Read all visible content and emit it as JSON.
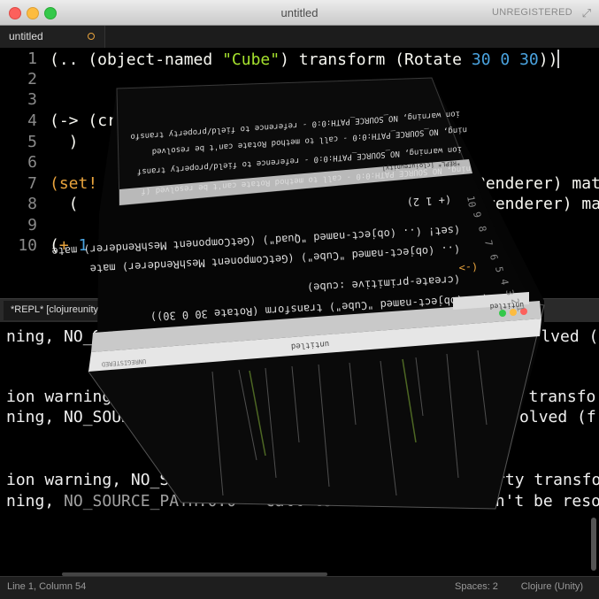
{
  "window": {
    "title": "untitled",
    "unregistered": "UNREGISTERED",
    "fullscreen_icon": "expand-arrows-icon"
  },
  "tabs": [
    {
      "label": "untitled",
      "modified": true
    }
  ],
  "editor": {
    "line_numbers": [
      "1",
      "2",
      "3",
      "4",
      "5",
      "6",
      "7",
      "8",
      "9",
      "10"
    ],
    "line1": {
      "a": "(.. (object-named ",
      "str": "\"Cube\"",
      "b": ") transform (Rotate ",
      "n1": "30",
      "n2": "0",
      "n3": "30",
      "c": "))"
    },
    "line4": {
      "op": "(->",
      "rest": " (cre"
    },
    "line5": "  )",
    "line7": {
      "op": "(set!",
      "rest": " (",
      "tail": "Renderer) mate"
    },
    "line8": {
      "rest": "  (",
      "tail": "renderer) mate"
    },
    "line10": {
      "open": "(",
      "op": "+",
      "n1": "1",
      "n2": "2",
      "close": ")"
    }
  },
  "repl": {
    "tab_label": "*REPL* [clojureunity]",
    "lines": [
      {
        "a": "ning, NO_SO",
        "b": "",
        "c": "resolved (f"
      },
      {
        "a": "ion warning, NO_SOURC",
        "b": "",
        "c": "property transfo"
      },
      {
        "a": "ning, NO_SOURC",
        "b": "",
        "c": "be resolved (f"
      },
      {
        "a": "ion warning, NO_SO",
        "b": "",
        "c": "reference to field/property transfo"
      },
      {
        "a": "ning, ",
        "b": "NO_SOURCE_PATH:0:0 - call to method Rotate",
        "c": " can't be resolved (f"
      }
    ]
  },
  "cube": {
    "top_face_lines": [
      "ion warning, NO_SOURCE_PATH:0:0 - reference to field/property transfo",
      "ning, NO_SOURCE_PATH:0:0 - call to method Rotate can't be resolved",
      "ion warning, NO_SOURCE_PATH:0:0 - reference to field/property transf",
      "ning, NO_SOURCE_PATH:0:0 - call to method Rotate can't be resolved (f"
    ],
    "top_face_tab": "*REPL* [clojureunity]",
    "front_face_lines": [
      "(+ 1 2)",
      "(set! (.. (object-named \"Quad\") (GetComponent MeshRenderer) mate",
      "  (.. (object-named \"Cube\") (GetComponent MeshRenderer) mate",
      "(->",
      "  (create-primitive :cube)",
      "(.. (object-named \"Cube\") transform (Rotate 30 0 30))"
    ],
    "front_face_tab": "untitled",
    "bottom_face_title": "untitled",
    "bottom_face_unreg": "UNREGISTERED",
    "side_line_numbers": [
      "10",
      "9",
      "8",
      "7",
      "6",
      "5",
      "4",
      "3",
      "2",
      "1"
    ]
  },
  "statusbar": {
    "position": "Line 1, Column 54",
    "spaces": "Spaces: 2",
    "syntax": "Clojure (Unity)"
  },
  "colors": {
    "string": "#a6e22e",
    "number": "#4aa3df",
    "operator": "#e8a33d",
    "text": "#f8f8f2",
    "background": "#000000"
  }
}
